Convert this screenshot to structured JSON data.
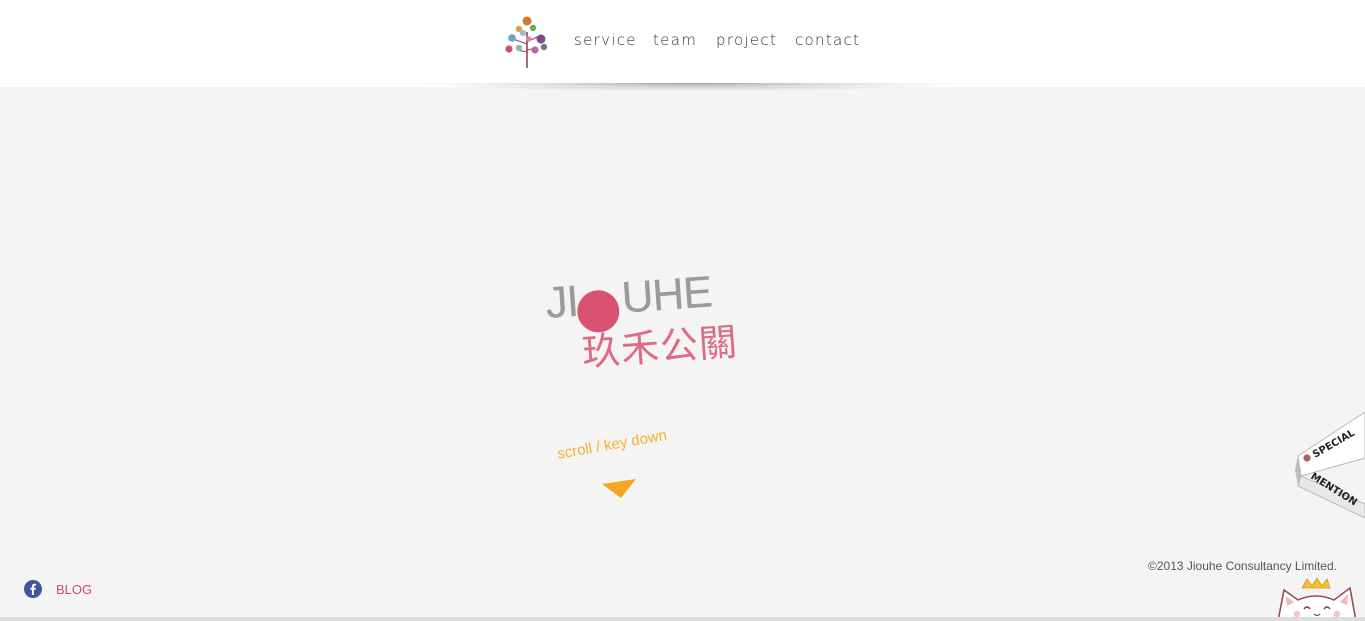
{
  "nav": {
    "items": [
      {
        "label": "service"
      },
      {
        "label": "team"
      },
      {
        "label": "project"
      },
      {
        "label": "contact"
      }
    ]
  },
  "brand": {
    "latin_parts": [
      "JI",
      "UHE"
    ],
    "chinese": "玖禾公關"
  },
  "hero": {
    "scroll_hint": "scroll / key down"
  },
  "footer": {
    "blog_label": "BLOG",
    "copyright": "©2013 Jiouhe Consultancy Limited."
  },
  "badge": {
    "line1": "SPECIAL",
    "line2": "MENTION"
  },
  "colors": {
    "brand_pink": "#d95371",
    "accent_orange": "#f5b02c",
    "facebook_blue": "#3b5998",
    "background": "#f4f4f4"
  },
  "icons": [
    "tree-logo-icon",
    "arrow-down-icon",
    "facebook-icon",
    "cat-mascot-icon"
  ]
}
